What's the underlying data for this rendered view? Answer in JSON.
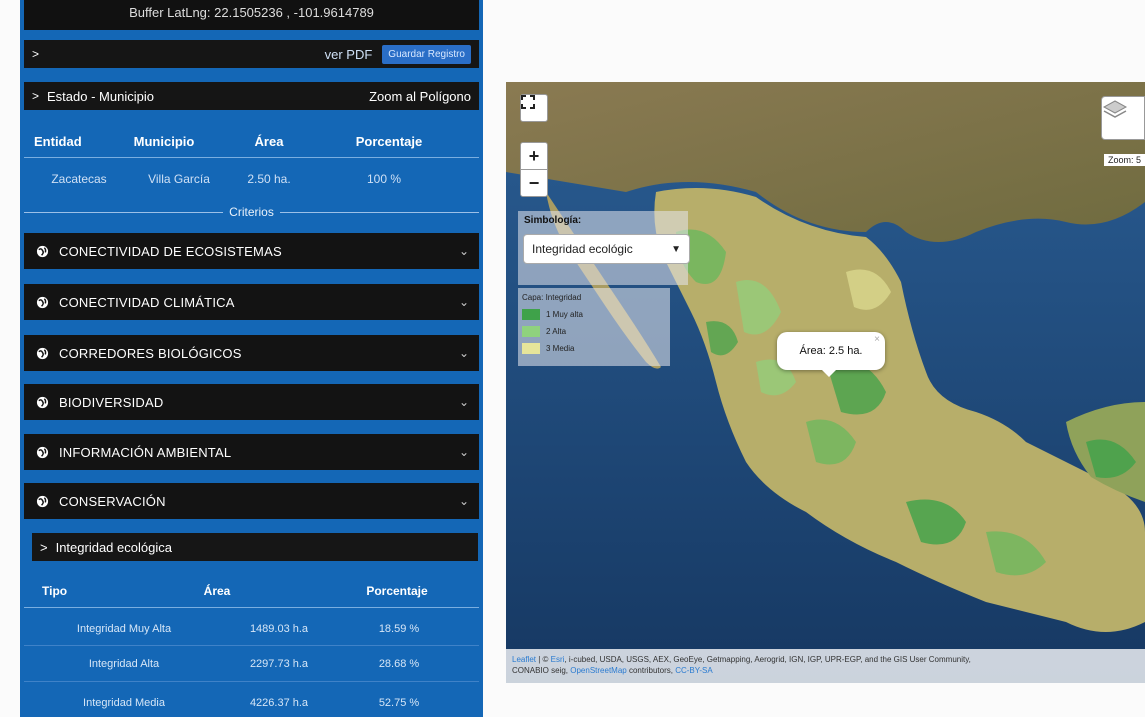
{
  "left_panel": {
    "buffer_text": "Buffer LatLng: 22.1505236 , -101.9614789",
    "toolbar": {
      "ver_pdf": "ver PDF",
      "save_label": "Guardar Registro"
    },
    "estado_bar": {
      "label": "Estado - Municipio",
      "zoom_link": "Zoom al Polígono"
    },
    "location_table": {
      "headers": [
        "Entidad",
        "Municipio",
        "Área",
        "Porcentaje"
      ],
      "row": [
        "Zacatecas",
        "Villa García",
        "2.50 ha.",
        "100 %"
      ]
    },
    "criteria_label": "Criterios",
    "accordions": [
      "CONECTIVIDAD DE ECOSISTEMAS",
      "CONECTIVIDAD CLIMÁTICA",
      "CORREDORES BIOLÓGICOS",
      "BIODIVERSIDAD",
      "INFORMACIÓN AMBIENTAL",
      "CONSERVACIÓN"
    ],
    "sub_section": "Integridad ecológica",
    "integrity_table": {
      "headers": [
        "Tipo",
        "Área",
        "Porcentaje"
      ],
      "rows": [
        [
          "Integridad Muy Alta",
          "1489.03 h.a",
          "18.59 %"
        ],
        [
          "Integridad Alta",
          "2297.73 h.a",
          "28.68 %"
        ],
        [
          "Integridad Media",
          "4226.37 h.a",
          "52.75 %"
        ]
      ]
    }
  },
  "map": {
    "zoom_in": "+",
    "zoom_out": "−",
    "zoom_text": "Zoom: 5",
    "symbology_label": "Simbología:",
    "symbology_value": "Integridad ecológic",
    "legend": {
      "title": "Capa: Integridad",
      "items": [
        {
          "label": "1 Muy alta",
          "color": "#3fa24a"
        },
        {
          "label": "2 Alta",
          "color": "#8fd27e"
        },
        {
          "label": "3 Media",
          "color": "#e6e59a"
        }
      ]
    },
    "popup_text": "Área: 2.5 ha.",
    "popup_close": "×",
    "attribution_line1_leaflet": "Leaflet",
    "attribution_line1_sep": " | © ",
    "attribution_line1_esri": "Esri",
    "attribution_line1_rest": ", i-cubed, USDA, USGS, AEX, GeoEye, Getmapping, Aerogrid, IGN, IGP, UPR-EGP, and the GIS User Community,",
    "attribution_line2_a": "CONABIO seig, ",
    "attribution_line2_osm": "OpenStreetMap",
    "attribution_line2_b": " contributors, ",
    "attribution_line2_cc": "CC-BY-SA"
  },
  "colors": {
    "panel_blue": "#1467b6",
    "bar_dark": "#131313",
    "water": "#1d3f6e"
  }
}
